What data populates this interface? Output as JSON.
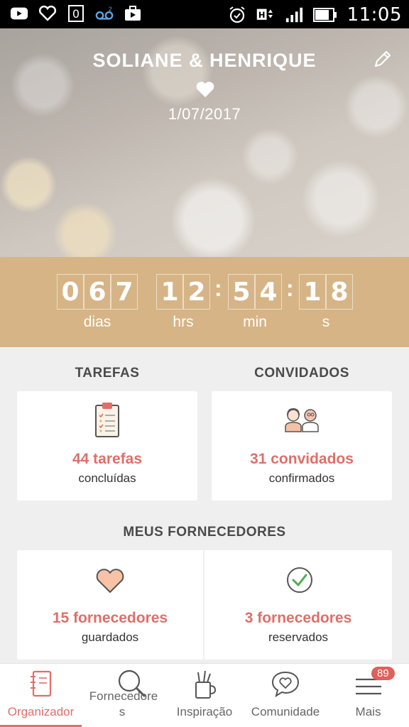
{
  "status_bar": {
    "time": "11:05",
    "left_icons": [
      "youtube-icon",
      "heart-outline-icon",
      "zero-icon",
      "voicemail-icon",
      "briefcase-icon"
    ],
    "right_icons": [
      "alarm-icon",
      "h-signal-icon",
      "signal-bars-icon",
      "battery-icon"
    ]
  },
  "hero": {
    "names": "SOLIANE & HENRIQUE",
    "date": "1/07/2017"
  },
  "countdown": {
    "days_digits": [
      "0",
      "6",
      "7"
    ],
    "hours_digits": [
      "1",
      "2"
    ],
    "minutes_digits": [
      "5",
      "4"
    ],
    "seconds_digits": [
      "1",
      "8"
    ],
    "labels": {
      "days": "dias",
      "hours": "hrs",
      "minutes": "min",
      "seconds": "s"
    }
  },
  "tasks": {
    "title": "TAREFAS",
    "value": "44 tarefas",
    "sub": "concluídas"
  },
  "guests": {
    "title": "CONVIDADOS",
    "value": "31 convidados",
    "sub": "confirmados"
  },
  "vendors": {
    "title": "MEUS FORNECEDORES",
    "saved_value": "15 fornecedores",
    "saved_sub": "guardados",
    "booked_value": "3 fornecedores",
    "booked_sub": "reservados"
  },
  "bottom_nav": {
    "organizer": "Organizador",
    "vendors_line1": "Fornecedore",
    "vendors_line2": "s",
    "inspiration": "Inspiração",
    "community": "Comunidade",
    "more": "Mais",
    "more_badge": "89",
    "active": "Organizador"
  },
  "colors": {
    "accent": "#df6f6a",
    "countdown_bg": "#d6b486"
  }
}
